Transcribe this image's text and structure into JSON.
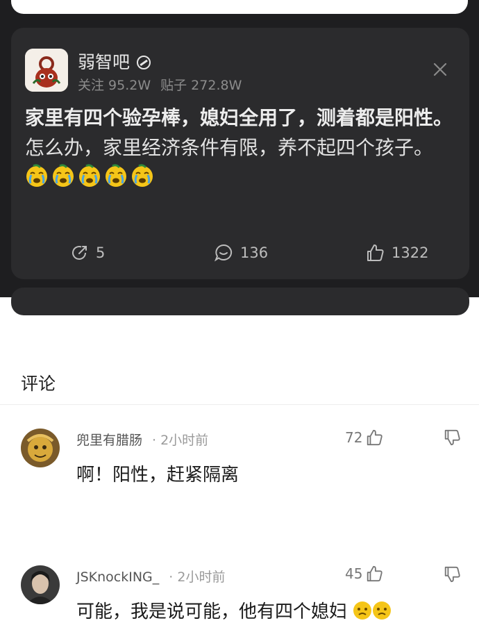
{
  "post": {
    "forum_name": "弱智吧",
    "followers": "关注 95.2W",
    "posts": "贴子 272.8W",
    "title": "家里有四个验孕棒，媳妇全用了，测着都是阳性。",
    "body": "怎么办，家里经济条件有限，养不起四个孩子。",
    "emoji_count": 5,
    "emoji_name": "crying-face-emoji",
    "shares": "5",
    "comments": "136",
    "likes": "1322"
  },
  "comments_section": {
    "title": "评论",
    "items": [
      {
        "user": "兜里有腊肠",
        "time": "· 2小时前",
        "likes": "72",
        "text": "啊！阳性，赶紧隔离"
      },
      {
        "user": "JSKnockING_",
        "time": "· 2小时前",
        "likes": "45",
        "text": "可能，我是说可能，他有四个媳妇"
      }
    ]
  },
  "colors": {
    "dark_bg": "#1e1e20",
    "card_bg": "#2b2b2d",
    "emoji_yellow": "#f5c518"
  }
}
